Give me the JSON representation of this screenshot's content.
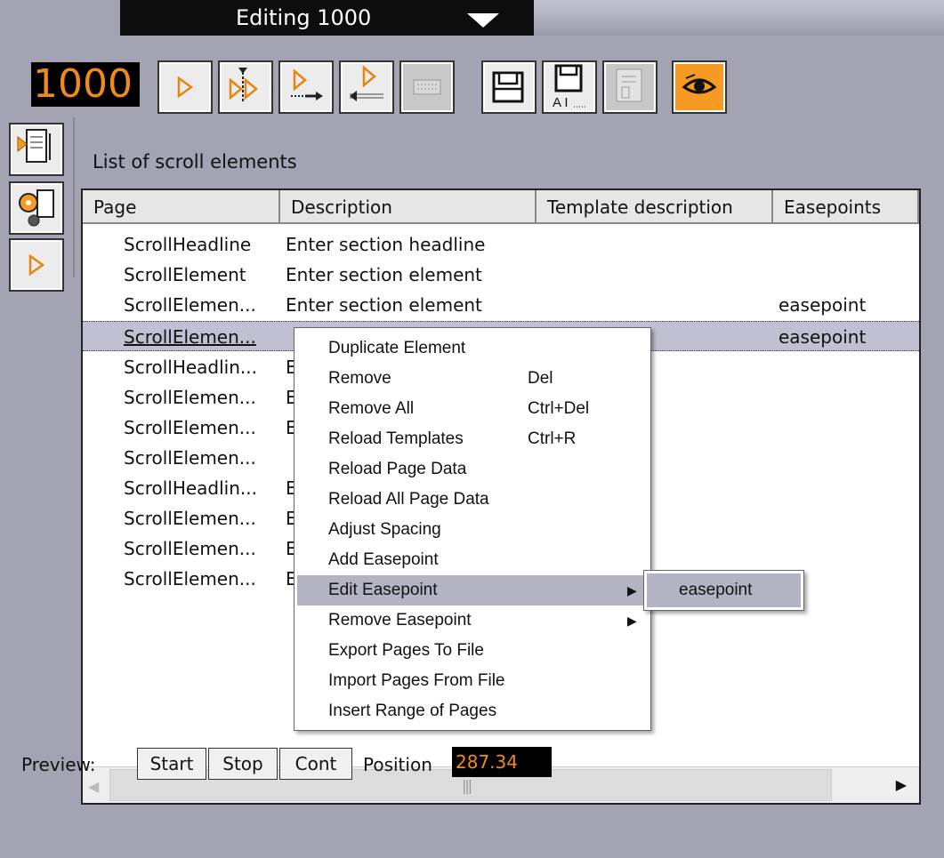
{
  "title_bar": {
    "title": "Editing 1000"
  },
  "page_number": "1000",
  "toolbar": {
    "buttons": [
      {
        "icon": "play-icon"
      },
      {
        "icon": "continue-icon"
      },
      {
        "icon": "take-next-icon"
      },
      {
        "icon": "take-previous-icon"
      },
      {
        "icon": "keyboard-icon"
      },
      {
        "icon": "save-icon"
      },
      {
        "icon": "save-as-icon"
      },
      {
        "icon": "template-icon"
      },
      {
        "icon": "preview-eye-icon"
      }
    ],
    "colors": {
      "active": "#f59a23",
      "page_number_text": "#f08a1c"
    }
  },
  "side_panel": {
    "buttons": [
      {
        "icon": "scroll-list-icon"
      },
      {
        "icon": "settings-gear-icon"
      },
      {
        "icon": "play-icon"
      }
    ]
  },
  "list": {
    "title": "List of scroll elements",
    "columns": [
      "Page",
      "Description",
      "Template description",
      "Easepoints"
    ],
    "rows": [
      {
        "page": "ScrollHeadline",
        "description": "Enter section headline",
        "easepoint": ""
      },
      {
        "page": "ScrollElement",
        "description": "Enter section element",
        "easepoint": ""
      },
      {
        "page": "ScrollElemen...",
        "description": "Enter section element",
        "easepoint": "easepoint"
      },
      {
        "page": "ScrollElemen...",
        "description": "",
        "easepoint": "easepoint",
        "selected": true
      },
      {
        "page": "ScrollHeadlin...",
        "description": "E",
        "easepoint": ""
      },
      {
        "page": "ScrollElemen...",
        "description": "E",
        "easepoint": ""
      },
      {
        "page": "ScrollElemen...",
        "description": "E",
        "easepoint": ""
      },
      {
        "page": "ScrollElemen...",
        "description": "",
        "easepoint": ""
      },
      {
        "page": "ScrollHeadlin...",
        "description": "E",
        "easepoint": ""
      },
      {
        "page": "ScrollElemen...",
        "description": "E",
        "easepoint": ""
      },
      {
        "page": "ScrollElemen...",
        "description": "E",
        "easepoint": ""
      },
      {
        "page": "ScrollElemen...",
        "description": "E",
        "easepoint": ""
      }
    ]
  },
  "context_menu": {
    "items": [
      {
        "label": "Duplicate Element",
        "shortcut": ""
      },
      {
        "label": "Remove",
        "shortcut": "Del"
      },
      {
        "label": "Remove All",
        "shortcut": "Ctrl+Del"
      },
      {
        "label": "Reload Templates",
        "shortcut": "Ctrl+R"
      },
      {
        "label": "Reload Page Data",
        "shortcut": ""
      },
      {
        "label": "Reload All Page Data",
        "shortcut": ""
      },
      {
        "label": "Adjust Spacing",
        "shortcut": ""
      },
      {
        "label": "Add Easepoint",
        "shortcut": ""
      },
      {
        "label": "Edit Easepoint",
        "shortcut": "",
        "submenu": true,
        "highlighted": true
      },
      {
        "label": "Remove Easepoint",
        "shortcut": "",
        "submenu": true
      },
      {
        "label": "Export Pages To File",
        "shortcut": ""
      },
      {
        "label": "Import Pages From File",
        "shortcut": ""
      },
      {
        "label": "Insert Range of Pages",
        "shortcut": ""
      }
    ],
    "submenu": {
      "items": [
        "easepoint"
      ]
    },
    "highlight_color": "#b3b3c4"
  },
  "preview": {
    "label": "Preview:",
    "buttons": [
      "Start",
      "Stop",
      "Cont"
    ],
    "position_label": "Position",
    "position_value": "287.34"
  }
}
